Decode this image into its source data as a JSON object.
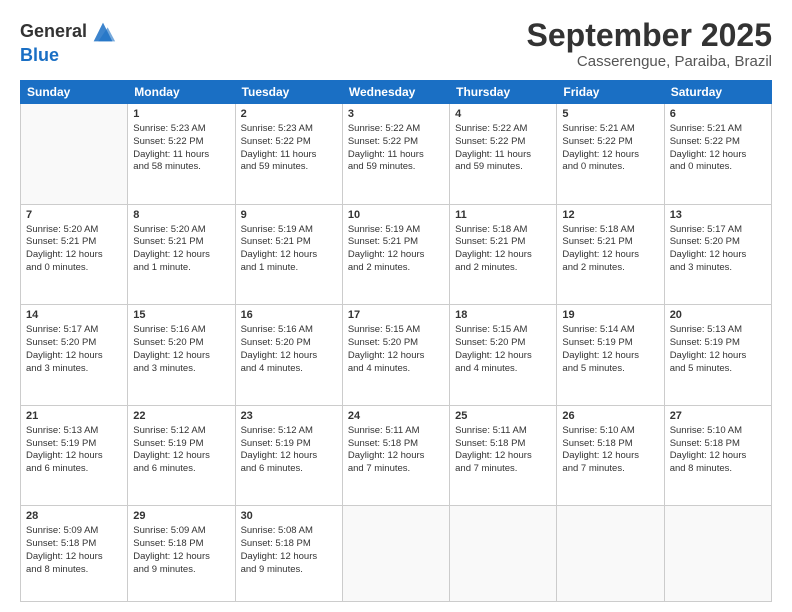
{
  "header": {
    "logo_line1": "General",
    "logo_line2": "Blue",
    "month": "September 2025",
    "location": "Casserengue, Paraiba, Brazil"
  },
  "weekdays": [
    "Sunday",
    "Monday",
    "Tuesday",
    "Wednesday",
    "Thursday",
    "Friday",
    "Saturday"
  ],
  "weeks": [
    [
      {
        "day": "",
        "info": ""
      },
      {
        "day": "1",
        "info": "Sunrise: 5:23 AM\nSunset: 5:22 PM\nDaylight: 11 hours\nand 58 minutes."
      },
      {
        "day": "2",
        "info": "Sunrise: 5:23 AM\nSunset: 5:22 PM\nDaylight: 11 hours\nand 59 minutes."
      },
      {
        "day": "3",
        "info": "Sunrise: 5:22 AM\nSunset: 5:22 PM\nDaylight: 11 hours\nand 59 minutes."
      },
      {
        "day": "4",
        "info": "Sunrise: 5:22 AM\nSunset: 5:22 PM\nDaylight: 11 hours\nand 59 minutes."
      },
      {
        "day": "5",
        "info": "Sunrise: 5:21 AM\nSunset: 5:22 PM\nDaylight: 12 hours\nand 0 minutes."
      },
      {
        "day": "6",
        "info": "Sunrise: 5:21 AM\nSunset: 5:22 PM\nDaylight: 12 hours\nand 0 minutes."
      }
    ],
    [
      {
        "day": "7",
        "info": "Sunrise: 5:20 AM\nSunset: 5:21 PM\nDaylight: 12 hours\nand 0 minutes."
      },
      {
        "day": "8",
        "info": "Sunrise: 5:20 AM\nSunset: 5:21 PM\nDaylight: 12 hours\nand 1 minute."
      },
      {
        "day": "9",
        "info": "Sunrise: 5:19 AM\nSunset: 5:21 PM\nDaylight: 12 hours\nand 1 minute."
      },
      {
        "day": "10",
        "info": "Sunrise: 5:19 AM\nSunset: 5:21 PM\nDaylight: 12 hours\nand 2 minutes."
      },
      {
        "day": "11",
        "info": "Sunrise: 5:18 AM\nSunset: 5:21 PM\nDaylight: 12 hours\nand 2 minutes."
      },
      {
        "day": "12",
        "info": "Sunrise: 5:18 AM\nSunset: 5:21 PM\nDaylight: 12 hours\nand 2 minutes."
      },
      {
        "day": "13",
        "info": "Sunrise: 5:17 AM\nSunset: 5:20 PM\nDaylight: 12 hours\nand 3 minutes."
      }
    ],
    [
      {
        "day": "14",
        "info": "Sunrise: 5:17 AM\nSunset: 5:20 PM\nDaylight: 12 hours\nand 3 minutes."
      },
      {
        "day": "15",
        "info": "Sunrise: 5:16 AM\nSunset: 5:20 PM\nDaylight: 12 hours\nand 3 minutes."
      },
      {
        "day": "16",
        "info": "Sunrise: 5:16 AM\nSunset: 5:20 PM\nDaylight: 12 hours\nand 4 minutes."
      },
      {
        "day": "17",
        "info": "Sunrise: 5:15 AM\nSunset: 5:20 PM\nDaylight: 12 hours\nand 4 minutes."
      },
      {
        "day": "18",
        "info": "Sunrise: 5:15 AM\nSunset: 5:20 PM\nDaylight: 12 hours\nand 4 minutes."
      },
      {
        "day": "19",
        "info": "Sunrise: 5:14 AM\nSunset: 5:19 PM\nDaylight: 12 hours\nand 5 minutes."
      },
      {
        "day": "20",
        "info": "Sunrise: 5:13 AM\nSunset: 5:19 PM\nDaylight: 12 hours\nand 5 minutes."
      }
    ],
    [
      {
        "day": "21",
        "info": "Sunrise: 5:13 AM\nSunset: 5:19 PM\nDaylight: 12 hours\nand 6 minutes."
      },
      {
        "day": "22",
        "info": "Sunrise: 5:12 AM\nSunset: 5:19 PM\nDaylight: 12 hours\nand 6 minutes."
      },
      {
        "day": "23",
        "info": "Sunrise: 5:12 AM\nSunset: 5:19 PM\nDaylight: 12 hours\nand 6 minutes."
      },
      {
        "day": "24",
        "info": "Sunrise: 5:11 AM\nSunset: 5:18 PM\nDaylight: 12 hours\nand 7 minutes."
      },
      {
        "day": "25",
        "info": "Sunrise: 5:11 AM\nSunset: 5:18 PM\nDaylight: 12 hours\nand 7 minutes."
      },
      {
        "day": "26",
        "info": "Sunrise: 5:10 AM\nSunset: 5:18 PM\nDaylight: 12 hours\nand 7 minutes."
      },
      {
        "day": "27",
        "info": "Sunrise: 5:10 AM\nSunset: 5:18 PM\nDaylight: 12 hours\nand 8 minutes."
      }
    ],
    [
      {
        "day": "28",
        "info": "Sunrise: 5:09 AM\nSunset: 5:18 PM\nDaylight: 12 hours\nand 8 minutes."
      },
      {
        "day": "29",
        "info": "Sunrise: 5:09 AM\nSunset: 5:18 PM\nDaylight: 12 hours\nand 9 minutes."
      },
      {
        "day": "30",
        "info": "Sunrise: 5:08 AM\nSunset: 5:18 PM\nDaylight: 12 hours\nand 9 minutes."
      },
      {
        "day": "",
        "info": ""
      },
      {
        "day": "",
        "info": ""
      },
      {
        "day": "",
        "info": ""
      },
      {
        "day": "",
        "info": ""
      }
    ]
  ]
}
